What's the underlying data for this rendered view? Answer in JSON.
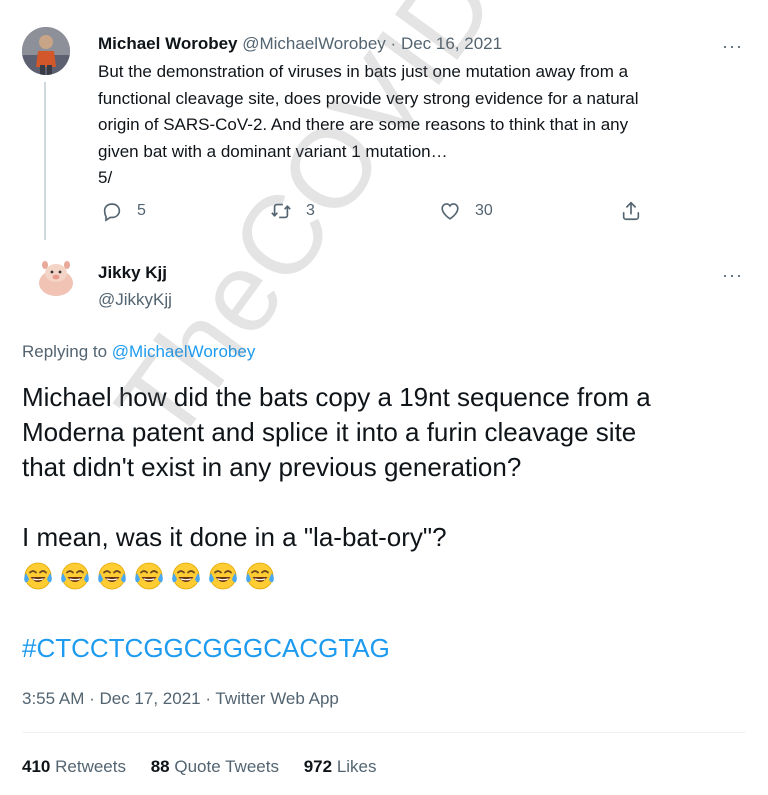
{
  "parent_tweet": {
    "author_name": "Michael Worobey",
    "handle": "@MichaelWorobey",
    "date": "Dec 16, 2021",
    "separator": "·",
    "text_lines": [
      "But the demonstration of viruses in bats just one mutation away  from a",
      "functional cleavage site, does provide very strong evidence for a natural",
      "origin of SARS-CoV-2.  And there are some reasons to think that in any",
      "given bat with a dominant variant 1 mutation…",
      "5/"
    ],
    "actions": {
      "reply_count": "5",
      "retweet_count": "3",
      "like_count": "30"
    },
    "more_label": "···"
  },
  "reply_tweet": {
    "author_name": "Jikky Kjj",
    "handle": "@JikkyKjj",
    "more_label": "···",
    "replying_prefix": "Replying to ",
    "replying_mention": "@MichaelWorobey",
    "text_lines": [
      "Michael how did the bats copy a 19nt sequence from a",
      "Moderna patent and splice it into a furin cleavage site",
      "that didn't exist in any previous generation?",
      "",
      "I mean, was it done in a \"la-bat-ory\"?"
    ],
    "emoji_count": 7,
    "emoji_name": "face-with-tears-of-joy",
    "hashtag": "#CTCCTCGGCGGGCACGTAG",
    "timestamp": "3:55 AM · Dec 17, 2021 · Twitter Web App",
    "stats": {
      "retweets_count": "410",
      "retweets_label": "Retweets",
      "quote_count": "88",
      "quote_label": "Quote Tweets",
      "likes_count": "972",
      "likes_label": "Likes"
    }
  },
  "watermark": "TheCOVIDBlog.com",
  "colors": {
    "text": "#0f1419",
    "secondary": "#536471",
    "link": "#1d9bf0",
    "thread_line": "#cfd9de",
    "divider": "#eff3f4"
  },
  "icons": [
    "reply-icon",
    "retweet-icon",
    "like-icon",
    "share-icon",
    "more-icon"
  ]
}
